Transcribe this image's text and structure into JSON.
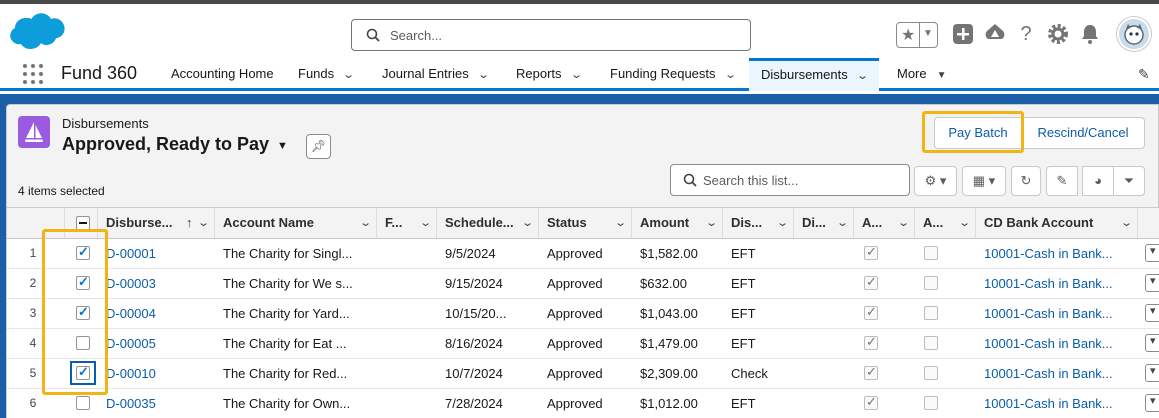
{
  "header": {
    "search_placeholder": "Search...",
    "icons": [
      "salesforce-cloud-logo",
      "star-icon",
      "plus-icon",
      "trailhead-icon",
      "help-icon",
      "gear-icon",
      "bell-icon",
      "avatar"
    ]
  },
  "nav": {
    "app_name": "Fund 360",
    "items": [
      {
        "label": "Accounting Home",
        "has_menu": false
      },
      {
        "label": "Funds",
        "has_menu": true
      },
      {
        "label": "Journal Entries",
        "has_menu": true
      },
      {
        "label": "Reports",
        "has_menu": true
      },
      {
        "label": "Funding Requests",
        "has_menu": true
      },
      {
        "label": "Disbursements",
        "has_menu": true,
        "active": true
      },
      {
        "label": "More",
        "has_menu": true
      }
    ]
  },
  "list": {
    "object_label": "Disbursements",
    "view_name": "Approved, Ready to Pay",
    "selected_text": "4 items selected",
    "search_placeholder": "Search this list...",
    "buttons": {
      "pay_batch": "Pay Batch",
      "rescind_cancel": "Rescind/Cancel"
    },
    "columns": [
      "Disburse...",
      "Account Name",
      "F...",
      "Schedule...",
      "Status",
      "Amount",
      "Dis...",
      "Di...",
      "A...",
      "A...",
      "CD Bank Account"
    ],
    "sort_indicator": "↑",
    "rows": [
      {
        "num": "1",
        "selected": true,
        "id": "D-00001",
        "account": "The Charity for Singl...",
        "scheduled": "9/5/2024",
        "status": "Approved",
        "amount": "$1,582.00",
        "method": "EFT",
        "a1": true,
        "a2": false,
        "bank": "10001-Cash in Bank..."
      },
      {
        "num": "2",
        "selected": true,
        "id": "D-00003",
        "account": "The Charity for We s...",
        "scheduled": "9/15/2024",
        "status": "Approved",
        "amount": "$632.00",
        "method": "EFT",
        "a1": true,
        "a2": false,
        "bank": "10001-Cash in Bank..."
      },
      {
        "num": "3",
        "selected": true,
        "id": "D-00004",
        "account": "The Charity for Yard...",
        "scheduled": "10/15/20...",
        "status": "Approved",
        "amount": "$1,043.00",
        "method": "EFT",
        "a1": true,
        "a2": false,
        "bank": "10001-Cash in Bank..."
      },
      {
        "num": "4",
        "selected": false,
        "id": "D-00005",
        "account": "The Charity for Eat ...",
        "scheduled": "8/16/2024",
        "status": "Approved",
        "amount": "$1,479.00",
        "method": "EFT",
        "a1": true,
        "a2": false,
        "bank": "10001-Cash in Bank..."
      },
      {
        "num": "5",
        "selected": true,
        "id": "D-00010",
        "account": "The Charity for Red...",
        "scheduled": "10/7/2024",
        "status": "Approved",
        "amount": "$2,309.00",
        "method": "Check",
        "a1": true,
        "a2": false,
        "bank": "10001-Cash in Bank..."
      },
      {
        "num": "6",
        "selected": false,
        "id": "D-00035",
        "account": "The Charity for Own...",
        "scheduled": "7/28/2024",
        "status": "Approved",
        "amount": "$1,012.00",
        "method": "EFT",
        "a1": true,
        "a2": false,
        "bank": "10001-Cash in Bank..."
      }
    ]
  },
  "colors": {
    "brand_blue": "#0176d3",
    "link": "#0b5cab",
    "highlight": "#f2b415",
    "object_icon": "#9a5be0",
    "banner": "#1b5fa8"
  }
}
